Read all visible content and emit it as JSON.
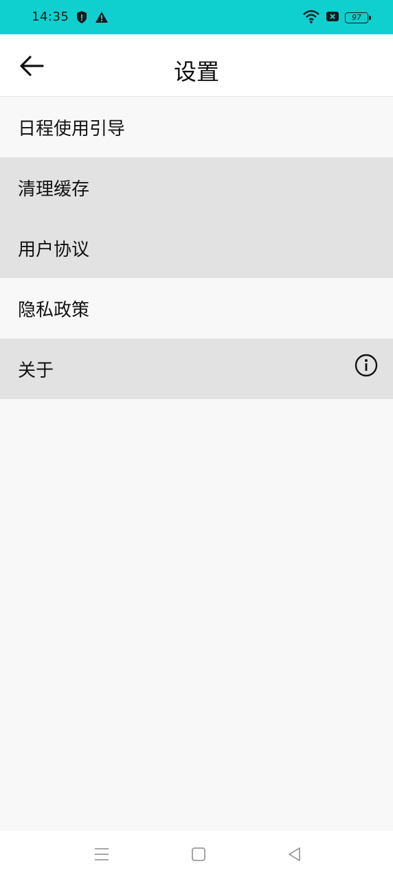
{
  "status_bar": {
    "time": "14:35",
    "battery": "97",
    "icons": [
      "shield-icon",
      "warning-icon",
      "wifi-icon",
      "sim-x-icon",
      "battery-icon"
    ],
    "background": "#0fcfcf"
  },
  "header": {
    "title": "设置",
    "back_icon": "arrow-left-icon"
  },
  "menu": {
    "items": [
      {
        "label": "日程使用引导"
      },
      {
        "label": "清理缓存"
      },
      {
        "label": "用户协议"
      },
      {
        "label": "隐私政策"
      },
      {
        "label": "关于",
        "icon": "info-icon"
      }
    ]
  },
  "nav_bar": {
    "buttons": [
      "menu-lines-icon",
      "home-square-icon",
      "back-triangle-icon"
    ]
  }
}
